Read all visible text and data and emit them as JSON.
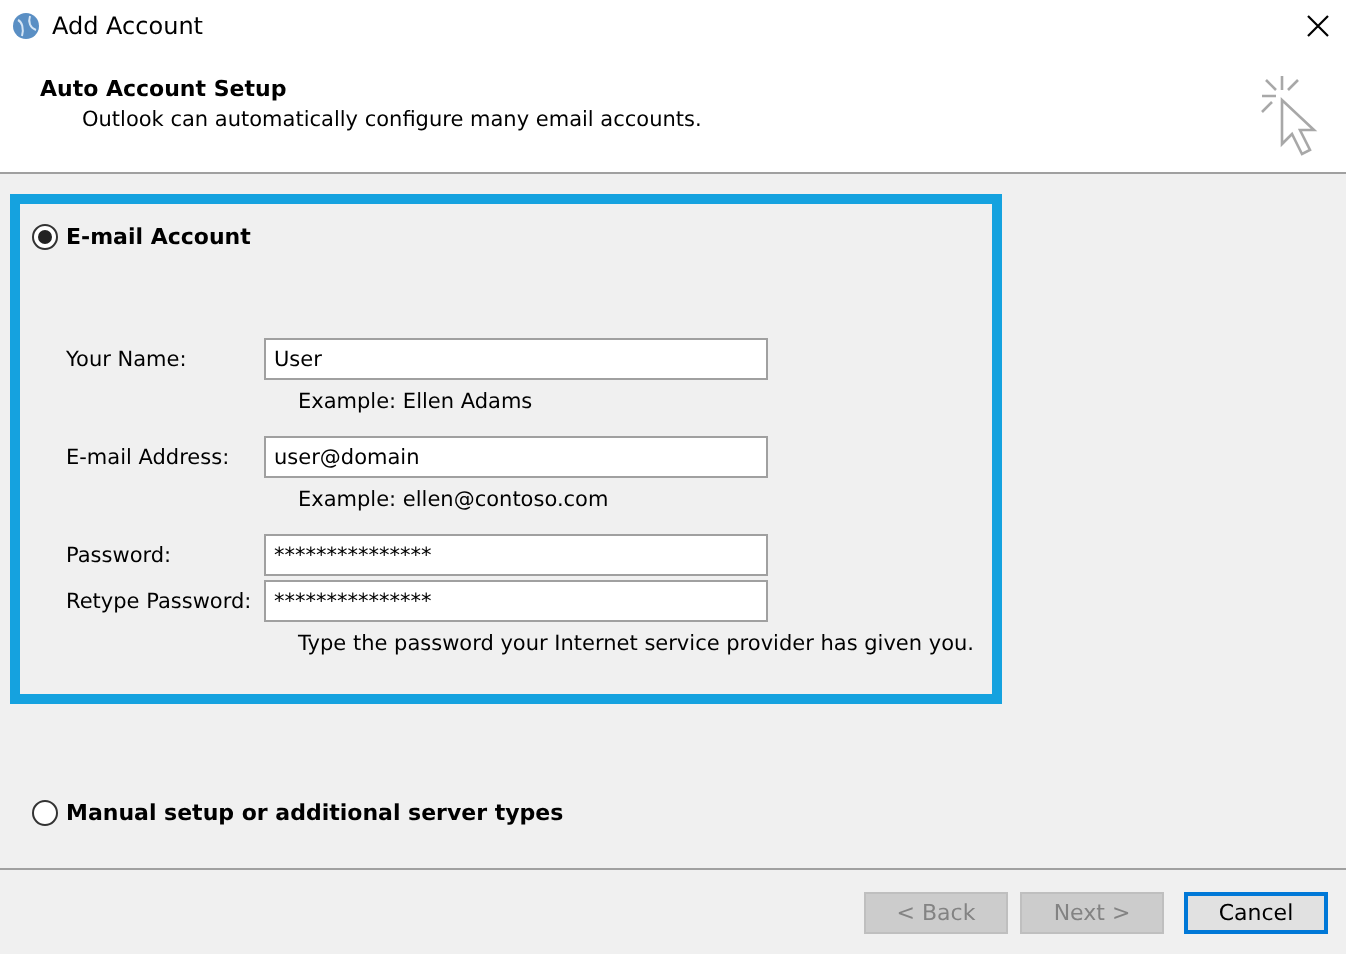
{
  "window": {
    "title": "Add Account"
  },
  "header": {
    "title": "Auto Account Setup",
    "subtitle": "Outlook can automatically configure many email accounts."
  },
  "options": [
    {
      "label": "E-mail Account",
      "selected": true,
      "highlighted": true,
      "fields": [
        {
          "label": "Your Name:",
          "value": "User",
          "hint": "Example: Ellen Adams"
        },
        {
          "label": "E-mail Address:",
          "value": "user@domain",
          "hint": "Example: ellen@contoso.com"
        },
        {
          "label": "Password:",
          "value": "***************"
        },
        {
          "label": "Retype Password:",
          "value": "***************",
          "hint": "Type the password your Internet service provider has given you."
        }
      ]
    },
    {
      "label": "Manual setup or additional server types",
      "selected": false,
      "highlighted": false
    }
  ],
  "buttons": [
    {
      "label": "< Back",
      "disabled": true,
      "default": false
    },
    {
      "label": "Next >",
      "disabled": true,
      "default": false
    },
    {
      "label": "Cancel",
      "disabled": false,
      "default": true
    }
  ]
}
